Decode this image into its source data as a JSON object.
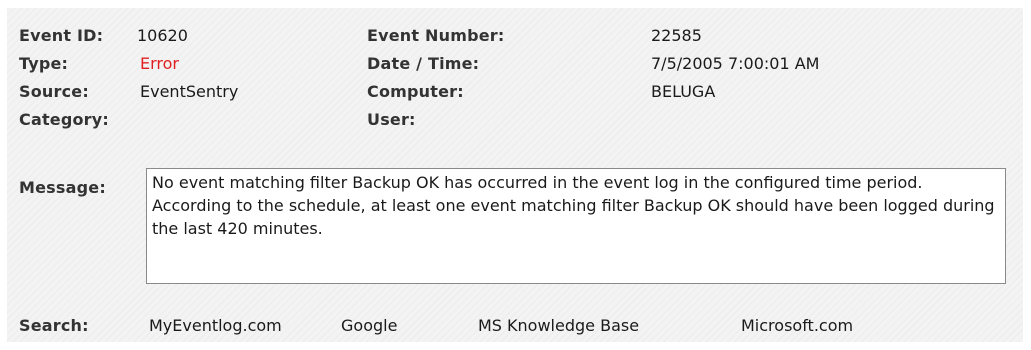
{
  "event": {
    "id_label": "Event ID:",
    "id_value": "10620",
    "type_label": "Type:",
    "type_value": "Error",
    "source_label": "Source:",
    "source_value": "EventSentry",
    "category_label": "Category:",
    "category_value": "",
    "number_label": "Event Number:",
    "number_value": "22585",
    "datetime_label": "Date / Time:",
    "datetime_value": "7/5/2005 7:00:01 AM",
    "computer_label": "Computer:",
    "computer_value": "BELUGA",
    "user_label": "User:",
    "user_value": ""
  },
  "message": {
    "label": "Message:",
    "text": "No event matching filter Backup OK has occurred in the event log in the configured time period. According to the schedule, at least one event matching filter Backup OK should have been logged during the last 420 minutes."
  },
  "search": {
    "label": "Search:",
    "links": [
      "MyEventlog.com",
      "Google",
      "MS Knowledge Base",
      "Microsoft.com"
    ]
  },
  "colors": {
    "error": "#e02020",
    "panel_background": "#f3f3f3"
  }
}
